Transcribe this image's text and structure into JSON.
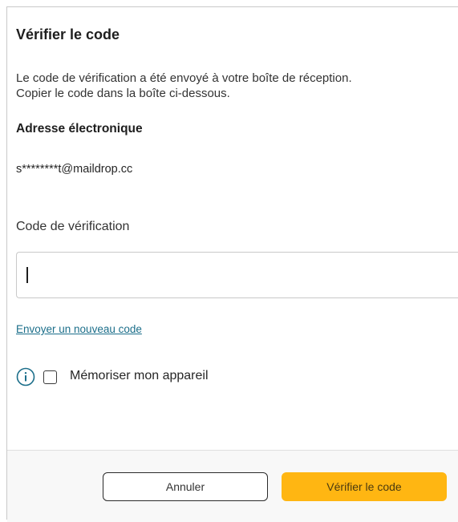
{
  "dialog": {
    "title": "Vérifier le code",
    "description_line1": "Le code de vérification a été envoyé à votre boîte de réception.",
    "description_line2": "Copier le code dans la boîte ci-dessous.",
    "email_label": "Adresse électronique",
    "email_value": "s********t@maildrop.cc",
    "code_label": "Code de vérification",
    "code_value": "",
    "resend_link": "Envoyer un nouveau code",
    "remember_label": "Mémoriser mon appareil",
    "remember_checked": false
  },
  "footer": {
    "cancel_label": "Annuler",
    "verify_label": "Vérifier le code"
  },
  "icons": {
    "info": "info-icon"
  },
  "colors": {
    "accent": "#ffb612",
    "link": "#1b6e8a",
    "info": "#1b6e8a",
    "border": "#c9c9c9"
  }
}
